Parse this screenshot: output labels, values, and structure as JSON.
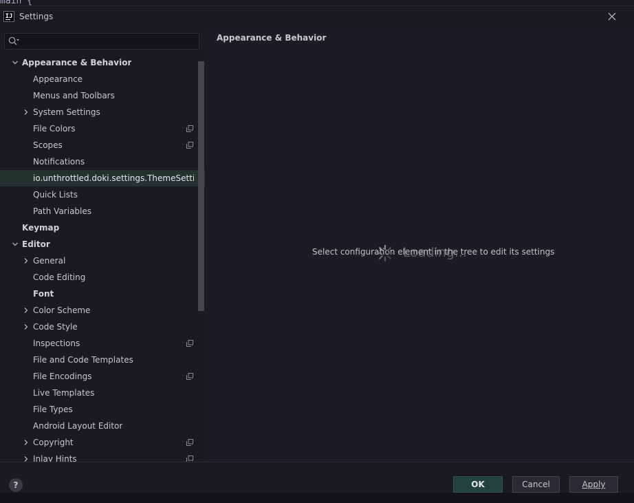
{
  "background_code": {
    "text": "main {"
  },
  "window": {
    "title": "Settings",
    "icon_label": "IJ"
  },
  "search": {
    "placeholder": "",
    "value": ""
  },
  "tree": {
    "items": [
      {
        "label": "Appearance & Behavior",
        "level": 0,
        "bold": true,
        "expandable": true,
        "expanded": true,
        "copy_icon": false,
        "selected": false
      },
      {
        "label": "Appearance",
        "level": 1,
        "bold": false,
        "expandable": false,
        "expanded": false,
        "copy_icon": false,
        "selected": false
      },
      {
        "label": "Menus and Toolbars",
        "level": 1,
        "bold": false,
        "expandable": false,
        "expanded": false,
        "copy_icon": false,
        "selected": false
      },
      {
        "label": "System Settings",
        "level": 1,
        "bold": false,
        "expandable": true,
        "expanded": false,
        "copy_icon": false,
        "selected": false
      },
      {
        "label": "File Colors",
        "level": 1,
        "bold": false,
        "expandable": false,
        "expanded": false,
        "copy_icon": true,
        "selected": false
      },
      {
        "label": "Scopes",
        "level": 1,
        "bold": false,
        "expandable": false,
        "expanded": false,
        "copy_icon": true,
        "selected": false
      },
      {
        "label": "Notifications",
        "level": 1,
        "bold": false,
        "expandable": false,
        "expanded": false,
        "copy_icon": false,
        "selected": false
      },
      {
        "label": "io.unthrottled.doki.settings.ThemeSettingsU",
        "level": 1,
        "bold": false,
        "expandable": false,
        "expanded": false,
        "copy_icon": false,
        "selected": true
      },
      {
        "label": "Quick Lists",
        "level": 1,
        "bold": false,
        "expandable": false,
        "expanded": false,
        "copy_icon": false,
        "selected": false
      },
      {
        "label": "Path Variables",
        "level": 1,
        "bold": false,
        "expandable": false,
        "expanded": false,
        "copy_icon": false,
        "selected": false
      },
      {
        "label": "Keymap",
        "level": 0,
        "bold": true,
        "expandable": false,
        "expanded": false,
        "copy_icon": false,
        "selected": false
      },
      {
        "label": "Editor",
        "level": 0,
        "bold": true,
        "expandable": true,
        "expanded": true,
        "copy_icon": false,
        "selected": false
      },
      {
        "label": "General",
        "level": 1,
        "bold": false,
        "expandable": true,
        "expanded": false,
        "copy_icon": false,
        "selected": false
      },
      {
        "label": "Code Editing",
        "level": 1,
        "bold": false,
        "expandable": false,
        "expanded": false,
        "copy_icon": false,
        "selected": false
      },
      {
        "label": "Font",
        "level": 1,
        "bold": true,
        "expandable": false,
        "expanded": false,
        "copy_icon": false,
        "selected": false
      },
      {
        "label": "Color Scheme",
        "level": 1,
        "bold": false,
        "expandable": true,
        "expanded": false,
        "copy_icon": false,
        "selected": false
      },
      {
        "label": "Code Style",
        "level": 1,
        "bold": false,
        "expandable": true,
        "expanded": false,
        "copy_icon": false,
        "selected": false
      },
      {
        "label": "Inspections",
        "level": 1,
        "bold": false,
        "expandable": false,
        "expanded": false,
        "copy_icon": true,
        "selected": false
      },
      {
        "label": "File and Code Templates",
        "level": 1,
        "bold": false,
        "expandable": false,
        "expanded": false,
        "copy_icon": false,
        "selected": false
      },
      {
        "label": "File Encodings",
        "level": 1,
        "bold": false,
        "expandable": false,
        "expanded": false,
        "copy_icon": true,
        "selected": false
      },
      {
        "label": "Live Templates",
        "level": 1,
        "bold": false,
        "expandable": false,
        "expanded": false,
        "copy_icon": false,
        "selected": false
      },
      {
        "label": "File Types",
        "level": 1,
        "bold": false,
        "expandable": false,
        "expanded": false,
        "copy_icon": false,
        "selected": false
      },
      {
        "label": "Android Layout Editor",
        "level": 1,
        "bold": false,
        "expandable": false,
        "expanded": false,
        "copy_icon": false,
        "selected": false
      },
      {
        "label": "Copyright",
        "level": 1,
        "bold": false,
        "expandable": true,
        "expanded": false,
        "copy_icon": true,
        "selected": false
      },
      {
        "label": "Inlay Hints",
        "level": 1,
        "bold": false,
        "expandable": true,
        "expanded": false,
        "copy_icon": true,
        "selected": false
      }
    ]
  },
  "main": {
    "header": "Appearance & Behavior",
    "empty_message": "Select configuration element in the tree to edit its settings",
    "loading_text": "Loading..."
  },
  "footer": {
    "help_label": "?",
    "ok_label": "OK",
    "cancel_label": "Cancel",
    "apply_label": "Apply"
  },
  "colors": {
    "background": "#1b1a21",
    "selection": "#23322f",
    "ok_button": "#24423d",
    "text": "#c8c8cc"
  },
  "icons": [
    "intellij-icon",
    "close-icon",
    "search-icon",
    "chevron-down-icon",
    "chevron-right-icon",
    "copy-icon",
    "spinner-icon",
    "help-icon"
  ]
}
